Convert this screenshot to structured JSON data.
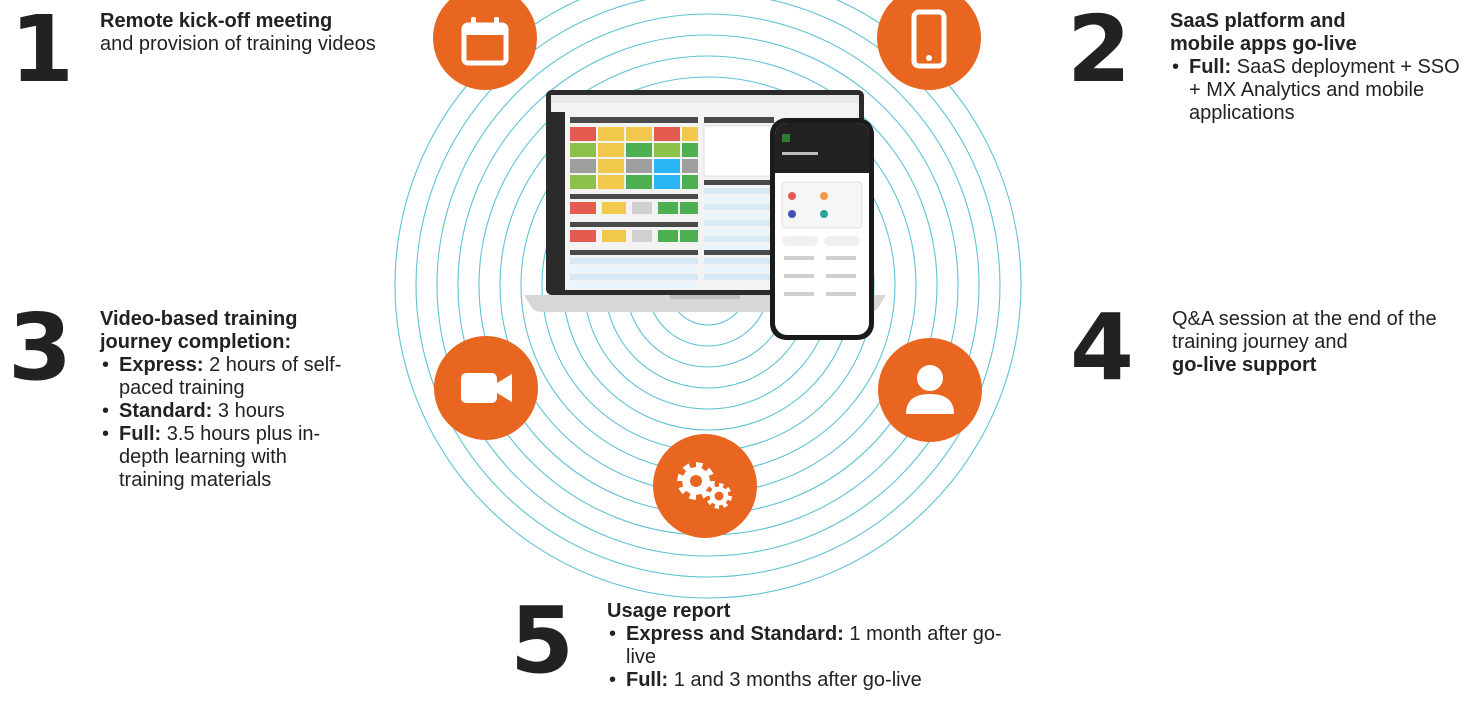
{
  "colors": {
    "accent": "#e8661f",
    "rings": "#5fc3d3",
    "text": "#222222"
  },
  "steps": [
    {
      "number": "1",
      "title": "Remote kick-off meeting",
      "text": "and provision of training videos"
    },
    {
      "number": "2",
      "title": "SaaS platform and mobile apps go-live",
      "bullets": [
        {
          "label": "Full:",
          "text": "SaaS deployment + SSO + MX Analytics and mobile applications"
        }
      ]
    },
    {
      "number": "3",
      "title": "Video-based training journey completion:",
      "bullets": [
        {
          "label": "Express:",
          "text": "2 hours of self-paced training"
        },
        {
          "label": "Standard:",
          "text": "3 hours"
        },
        {
          "label": "Full:",
          "text": "3.5 hours plus in-depth learning with training materials"
        }
      ]
    },
    {
      "number": "4",
      "text": "Q&A session at the end of the training journey and",
      "bold_text": "go-live support"
    },
    {
      "number": "5",
      "title": "Usage report",
      "bullets": [
        {
          "label": "Express and Standard:",
          "text": "1 month after go-live"
        },
        {
          "label": "Full:",
          "text": "1 and 3 months after go-live"
        }
      ]
    }
  ],
  "icons": [
    "calendar-icon",
    "smartphone-icon",
    "video-camera-icon",
    "user-icon",
    "gears-icon"
  ]
}
